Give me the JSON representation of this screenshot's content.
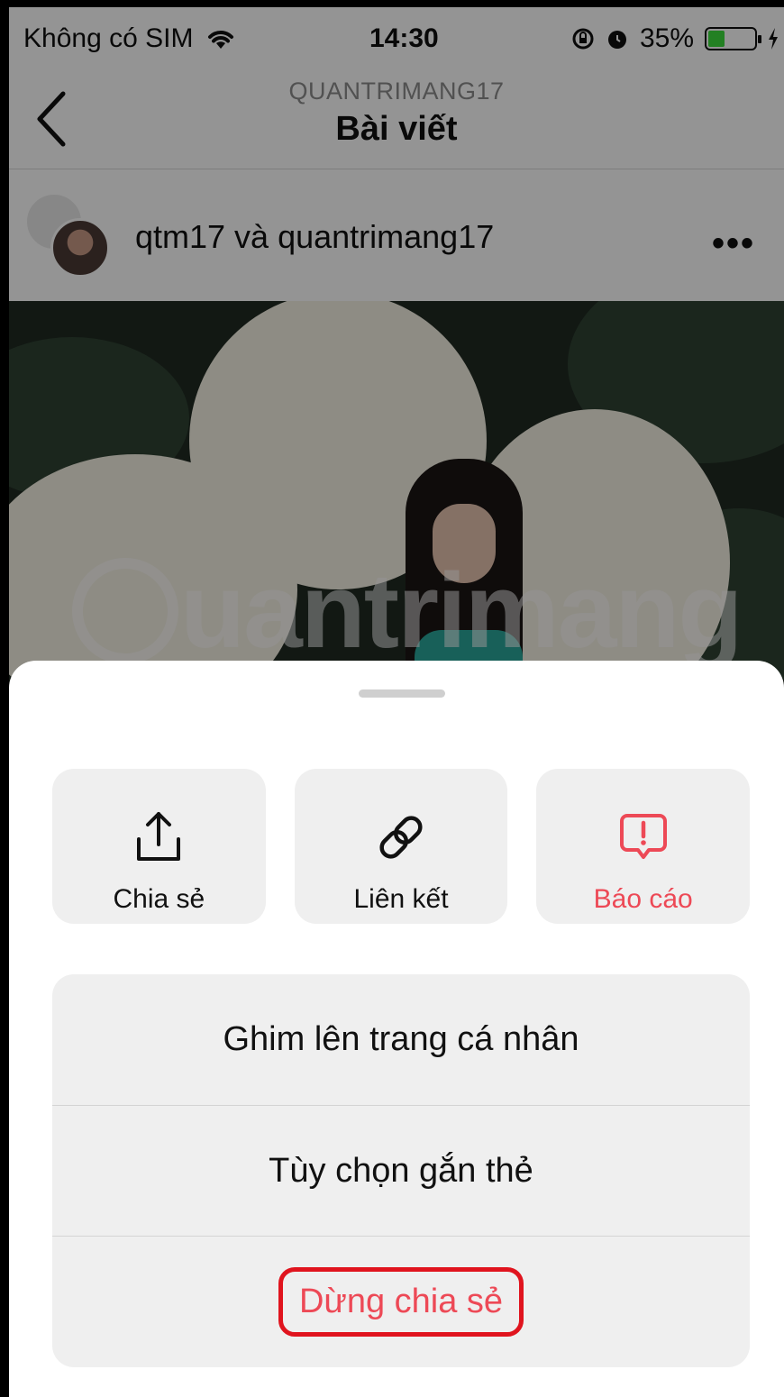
{
  "status_bar": {
    "carrier": "Không có SIM",
    "time": "14:30",
    "battery_percent": "35%",
    "battery_level": 0.35,
    "icons": [
      "wifi-icon",
      "rotation-lock-icon",
      "alarm-icon",
      "battery-icon",
      "charging-icon"
    ]
  },
  "header": {
    "username": "QUANTRIMANG17",
    "title": "Bài viết",
    "back_icon": "chevron-left-icon"
  },
  "post": {
    "users": "qtm17 và quantrimang17",
    "more_icon": "more-horizontal-icon",
    "more_label": "•••",
    "watermark_text": "uantrimang"
  },
  "sheet": {
    "actions": [
      {
        "label": "Chia sẻ",
        "icon": "share-icon"
      },
      {
        "label": "Liên kết",
        "icon": "link-icon"
      },
      {
        "label": "Báo cáo",
        "icon": "report-icon",
        "color": "#ed4956"
      }
    ],
    "options": [
      {
        "label": "Ghim lên trang cá nhân"
      },
      {
        "label": "Tùy chọn gắn thẻ"
      },
      {
        "label": "Dừng chia sẻ",
        "color": "#ed4956",
        "highlighted": true
      }
    ]
  },
  "colors": {
    "accent_red": "#ed4956",
    "highlight_border": "#e0141e",
    "card_bg": "#efefef"
  }
}
